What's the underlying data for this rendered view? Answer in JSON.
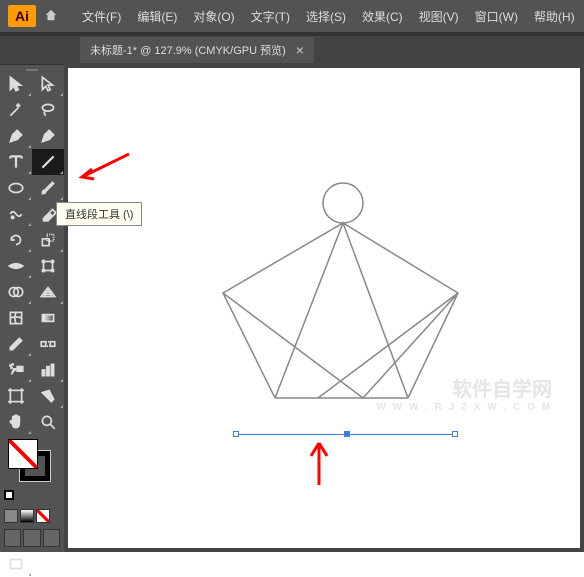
{
  "app": {
    "logo": "Ai"
  },
  "menubar": [
    "文件(F)",
    "编辑(E)",
    "对象(O)",
    "文字(T)",
    "选择(S)",
    "效果(C)",
    "视图(V)",
    "窗口(W)",
    "帮助(H)"
  ],
  "tab": {
    "title": "未标题-1* @ 127.9%  (CMYK/GPU 预览)",
    "close": "×"
  },
  "tooltip": "直线段工具 (\\)",
  "watermark": {
    "title": "软件自学网",
    "url": "W W W . R J Z X W . C O M"
  }
}
